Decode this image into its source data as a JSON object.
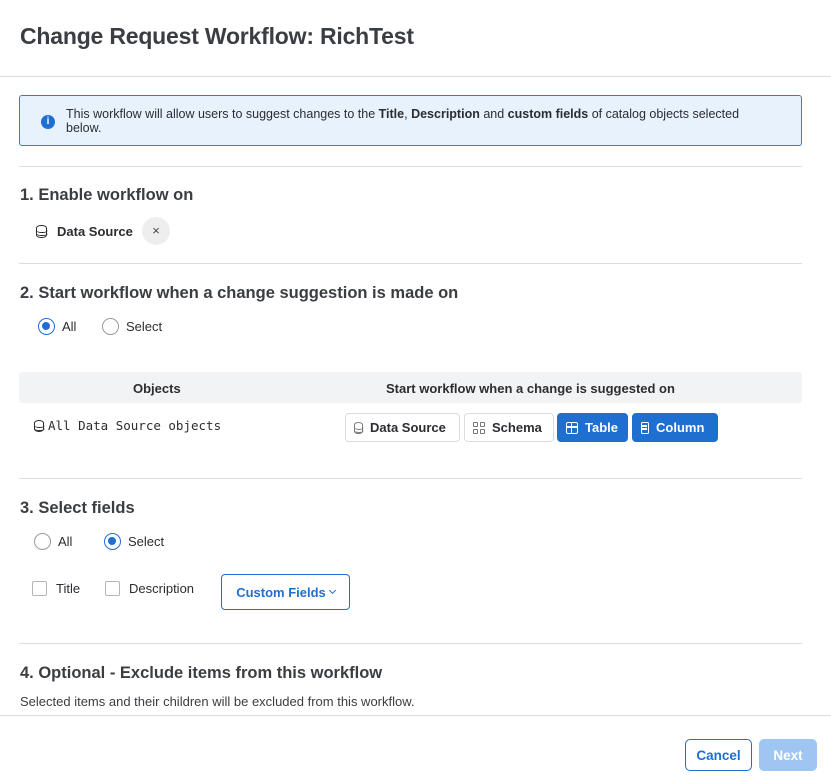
{
  "dialog": {
    "title": "Change Request Workflow: RichTest"
  },
  "info_banner": {
    "icon": "info-icon",
    "text_parts": [
      "This workflow will allow users to suggest changes to the ",
      "Title",
      ", ",
      "Description",
      " and ",
      "custom fields",
      " of catalog objects selected below."
    ]
  },
  "section1": {
    "heading": "1. Enable workflow on",
    "chip": {
      "icon": "database-icon",
      "label": "Data Source",
      "remove": "×"
    }
  },
  "section2": {
    "heading": "2. Start workflow when a change suggestion is made on",
    "radios": [
      {
        "label": "All",
        "checked": true
      },
      {
        "label": "Select",
        "checked": false
      }
    ],
    "table": {
      "headers": [
        "Objects",
        "Start workflow when a change is suggested on"
      ],
      "row": {
        "objects_label": "All Data Source objects",
        "types": [
          {
            "label": "Data Source",
            "icon": "database-icon",
            "selected": false
          },
          {
            "label": "Schema",
            "icon": "schema-icon",
            "selected": false
          },
          {
            "label": "Table",
            "icon": "table-icon",
            "selected": true
          },
          {
            "label": "Column",
            "icon": "column-icon",
            "selected": true
          }
        ]
      }
    }
  },
  "section3": {
    "heading": "3. Select fields",
    "radios": [
      {
        "label": "All",
        "checked": false
      },
      {
        "label": "Select",
        "checked": true
      }
    ],
    "checkboxes": [
      {
        "label": "Title",
        "checked": false
      },
      {
        "label": "Description",
        "checked": false
      }
    ],
    "custom_fields_label": "Custom Fields"
  },
  "section4": {
    "heading": "4. Optional - Exclude items from this workflow",
    "description": "Selected items and their children will be excluded from this workflow."
  },
  "footer": {
    "cancel_label": "Cancel",
    "next_label": "Next"
  },
  "colors": {
    "accent": "#1f6fd1",
    "banner_bg": "#e8f2fd",
    "next_disabled": "#9fc6f2"
  }
}
